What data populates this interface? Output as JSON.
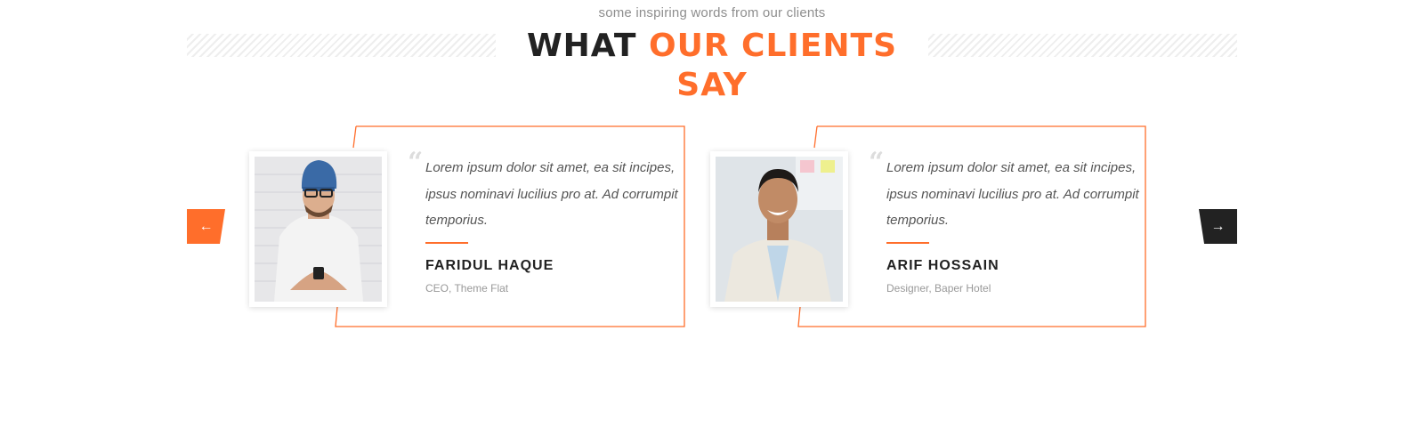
{
  "section": {
    "subtitle": "some inspiring words from our clients",
    "title_part1": "WHAT",
    "title_part2": "OUR CLIENTS SAY"
  },
  "colors": {
    "accent": "#ff6e2b",
    "dark": "#222222"
  },
  "navigation": {
    "prev_icon": "←",
    "next_icon": "→"
  },
  "testimonials": [
    {
      "quote": "Lorem ipsum dolor sit amet, ea sit incipes, ipsus nominavi lucilius pro at. Ad corrumpit temporius.",
      "name": "FARIDUL HAQUE",
      "role": "CEO, Theme Flat"
    },
    {
      "quote": "Lorem ipsum dolor sit amet, ea sit incipes, ipsus nominavi lucilius pro at. Ad corrumpit temporius.",
      "name": "ARIF HOSSAIN",
      "role": "Designer, Baper Hotel"
    }
  ]
}
